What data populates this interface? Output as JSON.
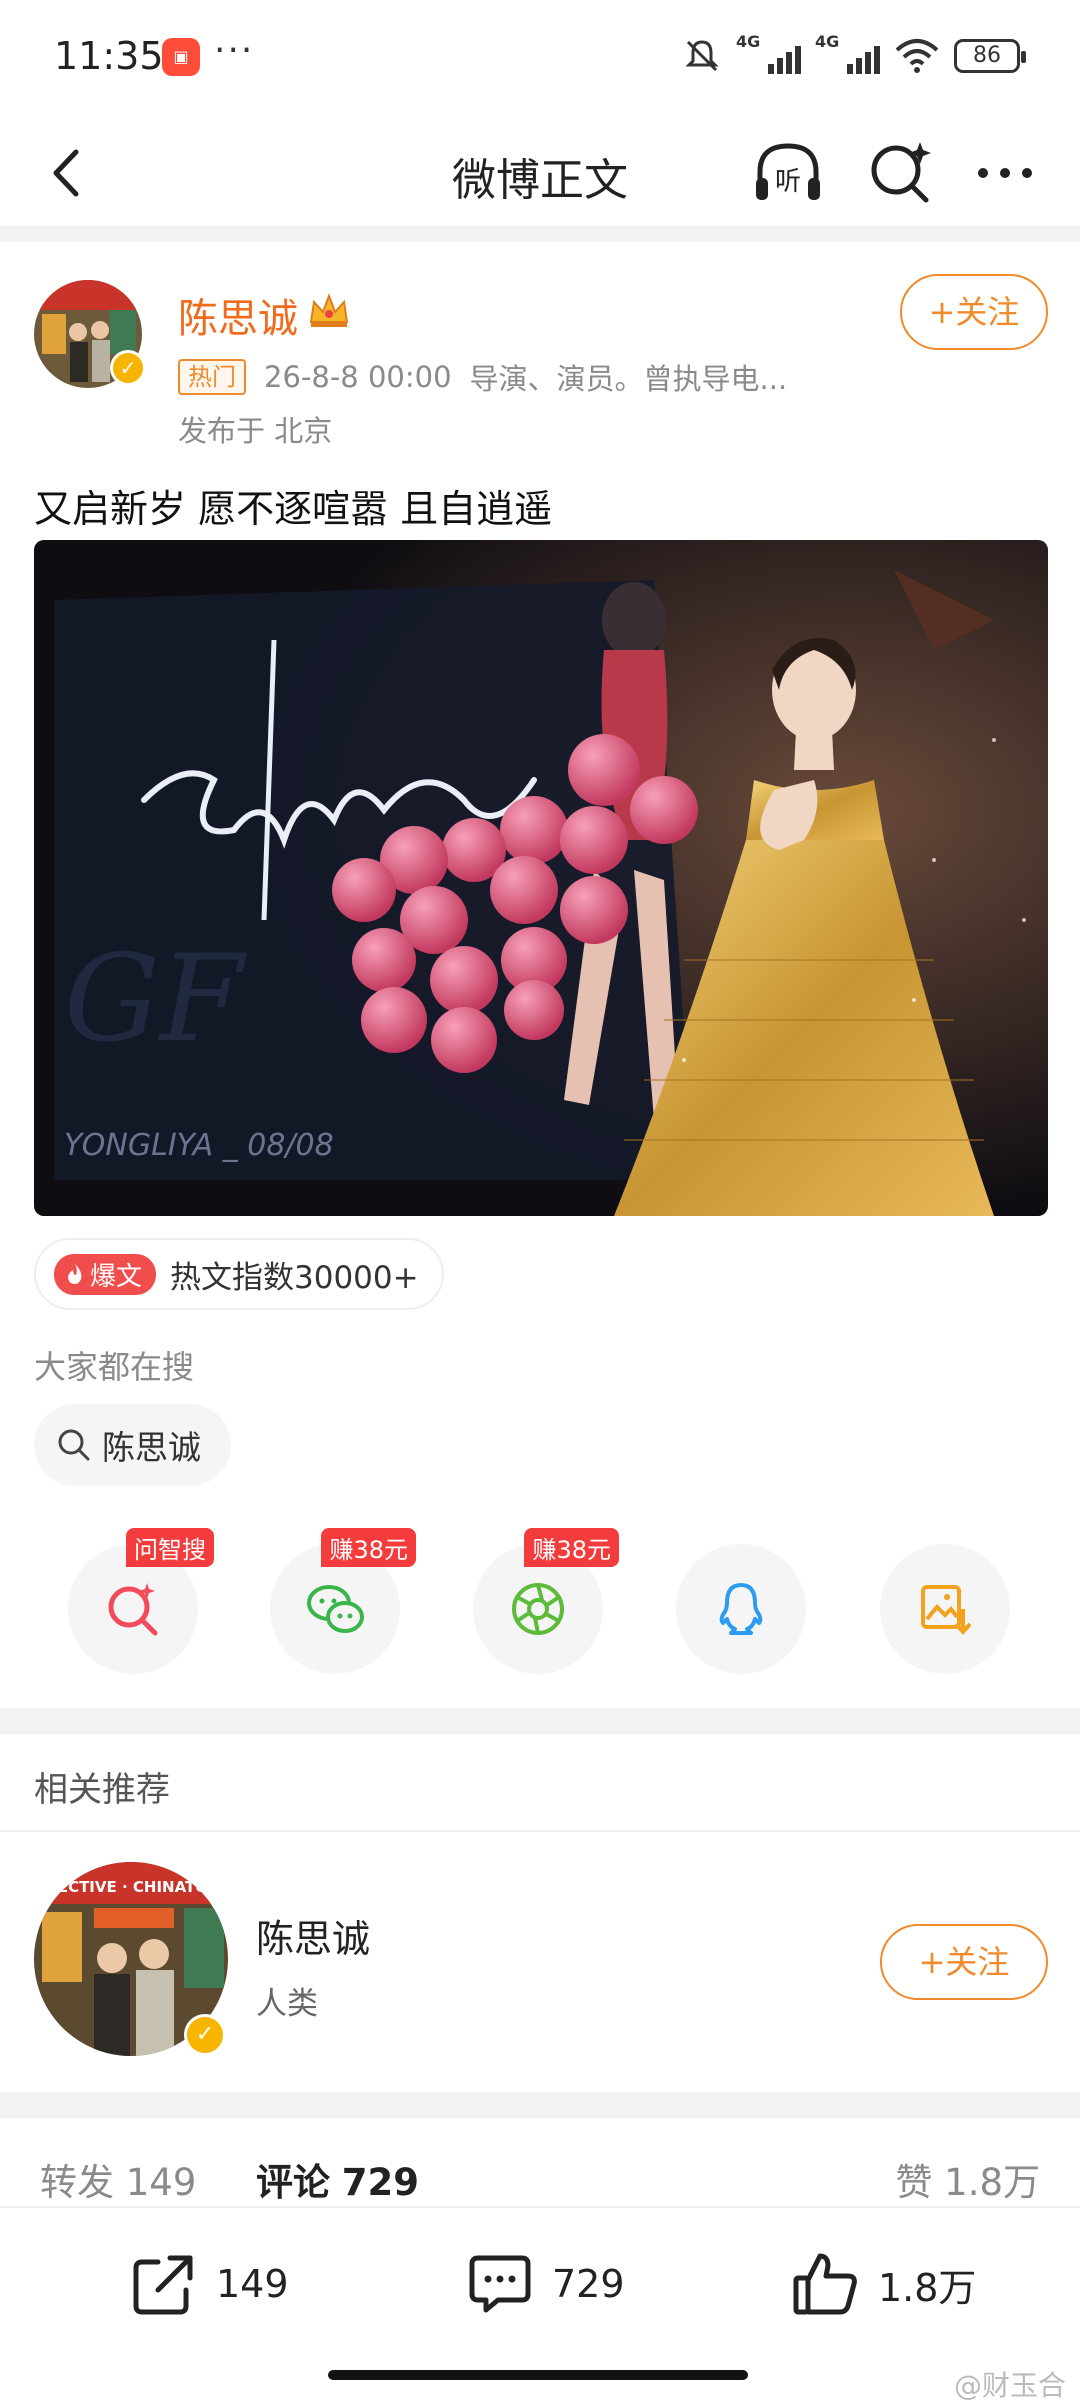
{
  "status_bar": {
    "time": "11:35",
    "app_icon": "app-notification-icon",
    "more": "···",
    "net1": "4G",
    "net2": "4G",
    "battery": "86"
  },
  "nav": {
    "title": "微博正文"
  },
  "post": {
    "author": "陈思诚",
    "hot_tag": "热门",
    "time": "26-8-8 00:00",
    "bio": "导演、演员。曾执导电...",
    "location": "发布于 北京",
    "follow": "+关注",
    "text": "又启新岁 愿不逐喧嚣 且自逍遥",
    "image_signature": "生日快乐",
    "image_caption": "YONGLIYA _ 08/08"
  },
  "hot_index": {
    "badge": "爆文",
    "text": "热文指数30000+"
  },
  "search": {
    "heading": "大家都在搜",
    "chip": "陈思诚"
  },
  "share": [
    {
      "icon": "zhisou-search-icon",
      "badge": "问智搜"
    },
    {
      "icon": "wechat-icon",
      "badge": "赚38元"
    },
    {
      "icon": "moments-icon",
      "badge": "赚38元"
    },
    {
      "icon": "qq-icon",
      "badge": ""
    },
    {
      "icon": "save-image-icon",
      "badge": ""
    }
  ],
  "related": {
    "title": "相关推荐",
    "name": "陈思诚",
    "desc": "人类",
    "follow": "+关注",
    "avatar_text": "DETECTIVE · CHINATOWN"
  },
  "counts": {
    "repost_label": "转发",
    "repost": "149",
    "comment_label": "评论",
    "comment": "729",
    "like_label": "赞",
    "like": "1.8万"
  },
  "bottom": {
    "repost": "149",
    "comment": "729",
    "like": "1.8万"
  },
  "watermark": "@财玉合",
  "colors": {
    "accent": "#f08a2b",
    "name": "#f26b1d",
    "badge_red": "#f43c3c",
    "gold": "#d9a441"
  }
}
